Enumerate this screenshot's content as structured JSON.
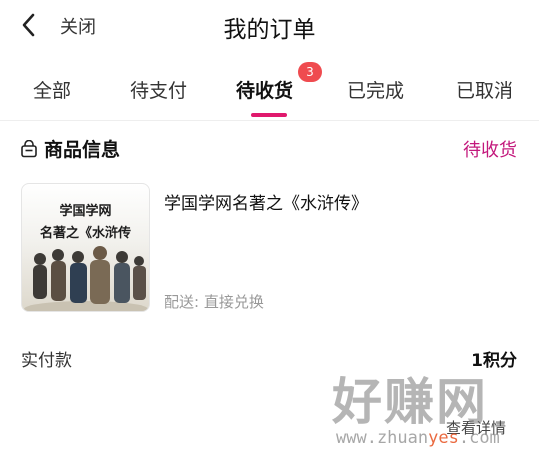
{
  "nav": {
    "close_label": "关闭",
    "title": "我的订单"
  },
  "tabs": [
    {
      "label": "全部"
    },
    {
      "label": "待支付"
    },
    {
      "label": "待收货",
      "active": true,
      "badge": "3"
    },
    {
      "label": "已完成"
    },
    {
      "label": "已取消"
    }
  ],
  "order": {
    "section_title": "商品信息",
    "status": "待收货",
    "product": {
      "image_line1": "学国学网",
      "image_line2": "名著之《水浒传",
      "name": "学国学网名著之《水浒传》",
      "delivery": "配送: 直接兑换"
    },
    "paid_label": "实付款",
    "paid_value": "1积分",
    "detail_button": "查看详情"
  },
  "watermark": {
    "title": "好赚网",
    "url_prefix": "www.zhuan",
    "url_highlight": "yes",
    "url_suffix": ".com"
  },
  "colors": {
    "accent": "#e0196d",
    "status": "#c3187c",
    "badge": "#ef4b4f"
  }
}
